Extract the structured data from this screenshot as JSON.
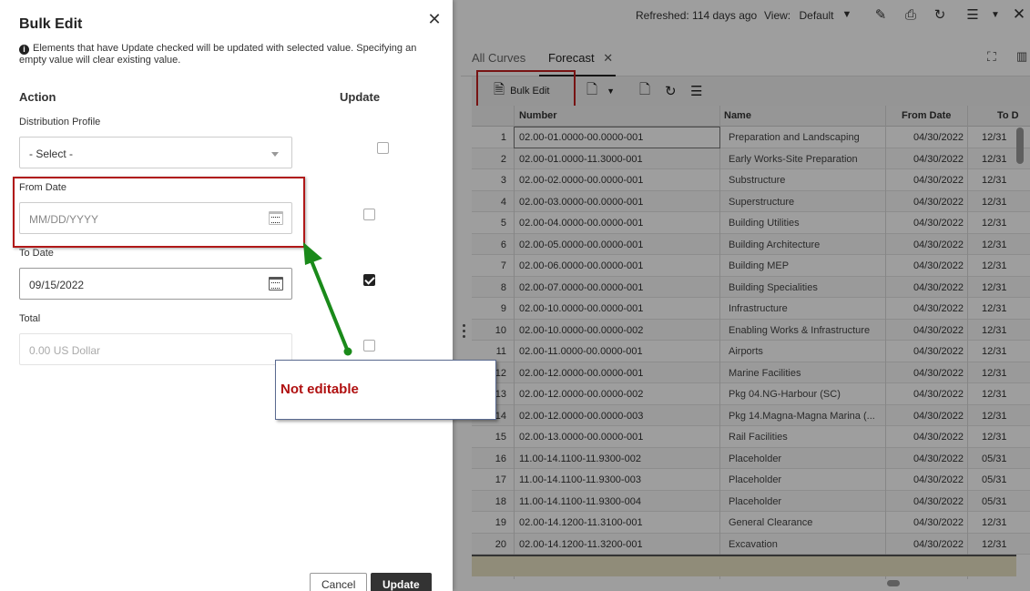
{
  "topbar": {
    "refreshed_label": "Refreshed:",
    "refreshed_value": "114 days ago",
    "view_label": "View:",
    "view_value": "Default",
    "icons": [
      "caret-down-icon",
      "pencil-icon",
      "print-icon",
      "refresh-icon",
      "hamburger-menu-icon",
      "chevron-down-icon",
      "close-icon"
    ]
  },
  "tabs": [
    {
      "label": "All Curves"
    },
    {
      "label": "Forecast"
    }
  ],
  "toolbar": {
    "bulk_edit_label": "Bulk Edit"
  },
  "grid": {
    "columns": [
      "Number",
      "Name",
      "From Date",
      "To D"
    ],
    "rows": [
      {
        "idx": "1",
        "number": "02.00-01.0000-00.0000-001",
        "name": "Preparation and Landscaping",
        "from": "04/30/2022",
        "to": "12/31"
      },
      {
        "idx": "2",
        "number": "02.00-01.0000-11.3000-001",
        "name": "Early Works-Site Preparation",
        "from": "04/30/2022",
        "to": "12/31"
      },
      {
        "idx": "3",
        "number": "02.00-02.0000-00.0000-001",
        "name": "Substructure",
        "from": "04/30/2022",
        "to": "12/31"
      },
      {
        "idx": "4",
        "number": "02.00-03.0000-00.0000-001",
        "name": "Superstructure",
        "from": "04/30/2022",
        "to": "12/31"
      },
      {
        "idx": "5",
        "number": "02.00-04.0000-00.0000-001",
        "name": "Building Utilities",
        "from": "04/30/2022",
        "to": "12/31"
      },
      {
        "idx": "6",
        "number": "02.00-05.0000-00.0000-001",
        "name": "Building Architecture",
        "from": "04/30/2022",
        "to": "12/31"
      },
      {
        "idx": "7",
        "number": "02.00-06.0000-00.0000-001",
        "name": "Building MEP",
        "from": "04/30/2022",
        "to": "12/31"
      },
      {
        "idx": "8",
        "number": "02.00-07.0000-00.0000-001",
        "name": "Building Specialities",
        "from": "04/30/2022",
        "to": "12/31"
      },
      {
        "idx": "9",
        "number": "02.00-10.0000-00.0000-001",
        "name": "Infrastructure",
        "from": "04/30/2022",
        "to": "12/31"
      },
      {
        "idx": "10",
        "number": "02.00-10.0000-00.0000-002",
        "name": "Enabling Works & Infrastructure",
        "from": "04/30/2022",
        "to": "12/31"
      },
      {
        "idx": "11",
        "number": "02.00-11.0000-00.0000-001",
        "name": "Airports",
        "from": "04/30/2022",
        "to": "12/31"
      },
      {
        "idx": "12",
        "number": "02.00-12.0000-00.0000-001",
        "name": "Marine Facilities",
        "from": "04/30/2022",
        "to": "12/31"
      },
      {
        "idx": "13",
        "number": "02.00-12.0000-00.0000-002",
        "name": "Pkg 04.NG-Harbour (SC)",
        "from": "04/30/2022",
        "to": "12/31"
      },
      {
        "idx": "14",
        "number": "02.00-12.0000-00.0000-003",
        "name": "Pkg 14.Magna-Magna Marina (...",
        "from": "04/30/2022",
        "to": "12/31"
      },
      {
        "idx": "15",
        "number": "02.00-13.0000-00.0000-001",
        "name": "Rail Facilities",
        "from": "04/30/2022",
        "to": "12/31"
      },
      {
        "idx": "16",
        "number": "11.00-14.1100-11.9300-002",
        "name": "Placeholder",
        "from": "04/30/2022",
        "to": "05/31"
      },
      {
        "idx": "17",
        "number": "11.00-14.1100-11.9300-003",
        "name": "Placeholder",
        "from": "04/30/2022",
        "to": "05/31"
      },
      {
        "idx": "18",
        "number": "11.00-14.1100-11.9300-004",
        "name": "Placeholder",
        "from": "04/30/2022",
        "to": "05/31"
      },
      {
        "idx": "19",
        "number": "02.00-14.1200-11.3100-001",
        "name": "General Clearance",
        "from": "04/30/2022",
        "to": "12/31"
      },
      {
        "idx": "20",
        "number": "02.00-14.1200-11.3200-001",
        "name": "Excavation",
        "from": "04/30/2022",
        "to": "12/31"
      }
    ]
  },
  "panel": {
    "title": "Bulk Edit",
    "info": "Elements that have Update checked will be updated with selected value. Specifying an empty value will clear existing value.",
    "action_header": "Action",
    "update_header": "Update",
    "fields": {
      "distribution_profile": {
        "label": "Distribution Profile",
        "value": "- Select -",
        "checked": false
      },
      "from_date": {
        "label": "From Date",
        "placeholder": "MM/DD/YYYY",
        "checked": false
      },
      "to_date": {
        "label": "To Date",
        "value": "09/15/2022",
        "checked": true
      },
      "total": {
        "label": "Total",
        "value": "0.00 US Dollar",
        "checked": false
      }
    },
    "cancel_label": "Cancel",
    "update_label": "Update"
  },
  "annotation": {
    "callout_text": "Not editable",
    "box_color": "#b01818",
    "arrow_color": "#1a8a1a"
  }
}
